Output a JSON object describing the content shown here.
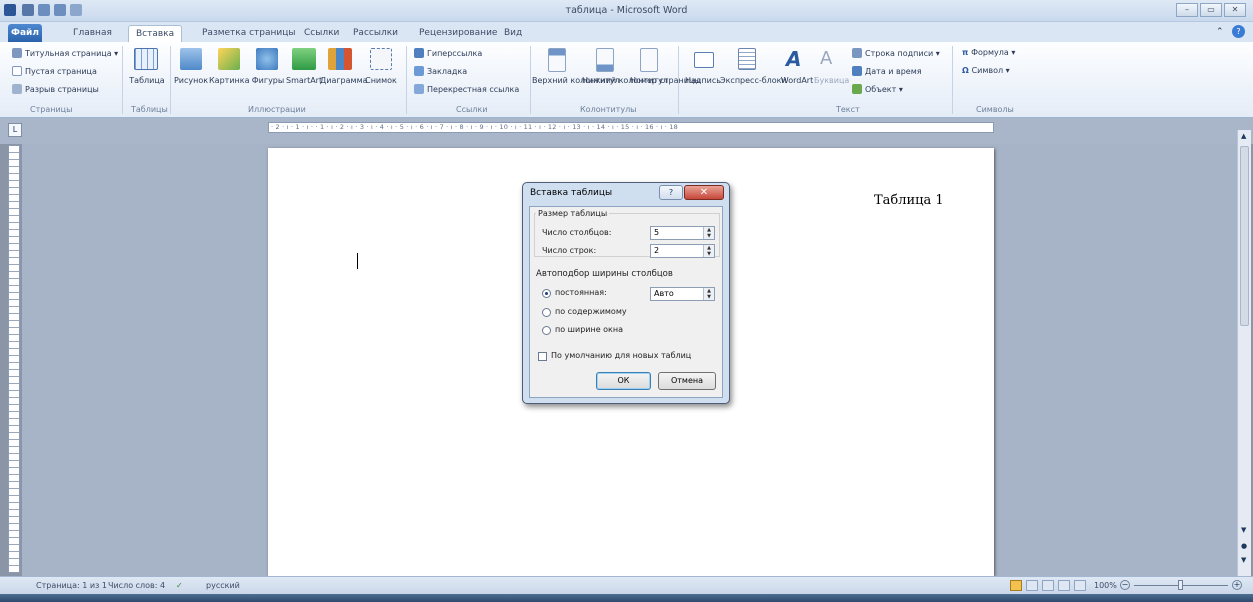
{
  "window": {
    "title": "таблица - Microsoft Word"
  },
  "tabs": {
    "file": "Файл",
    "items": [
      "Главная",
      "Вставка",
      "Разметка страницы",
      "Ссылки",
      "Рассылки",
      "Рецензирование",
      "Вид"
    ],
    "active": "Вставка"
  },
  "ribbon": {
    "pages": {
      "items": [
        "Титульная страница",
        "Пустая страница",
        "Разрыв страницы"
      ],
      "label": "Страницы"
    },
    "tables": {
      "button": "Таблица",
      "label": "Таблицы"
    },
    "illustrations": {
      "buttons": [
        "Рисунок",
        "Картинка",
        "Фигуры",
        "SmartArt",
        "Диаграмма",
        "Снимок"
      ],
      "label": "Иллюстрации"
    },
    "links": {
      "items": [
        "Гиперссылка",
        "Закладка",
        "Перекрестная ссылка"
      ],
      "label": "Ссылки"
    },
    "header_footer": {
      "buttons": [
        "Верхний колонтитул",
        "Нижний колонтитул",
        "Номер страницы"
      ],
      "label": "Колонтитулы"
    },
    "text": {
      "buttons": [
        "Надпись",
        "Экспресс-блоки",
        "WordArt",
        "Буквица"
      ],
      "right_items": [
        "Строка подписи",
        "Дата и время",
        "Объект"
      ],
      "label": "Текст"
    },
    "symbols": {
      "items": [
        "Формула",
        "Символ"
      ],
      "label": "Символы"
    }
  },
  "ruler": {
    "marks": "· 2 · ı · 1 · ı ·  · 1 · ı · 2 · ı · 3 · ı · 4 · ı · 5 · ı · 6 · ı · 7 · ı · 8 · ı · 9 · ı · 10 · ı · 11 · ı · 12 · ı · 13 · ı · 14 · ı · 15 · ı · 16 · ı · 18"
  },
  "document": {
    "caption": "Таблица 1"
  },
  "dialog": {
    "title": "Вставка таблицы",
    "size_group": "Размер таблицы",
    "columns_label": "Число столбцов:",
    "columns_value": "5",
    "rows_label": "Число строк:",
    "rows_value": "2",
    "autofit_group": "Автоподбор ширины столбцов",
    "fixed_label": "постоянная:",
    "fixed_value": "Авто",
    "content_label": "по содержимому",
    "window_label": "по ширине окна",
    "default_label": "По умолчанию для новых таблиц",
    "ok": "ОК",
    "cancel": "Отмена"
  },
  "status": {
    "page": "Страница: 1 из 1",
    "words": "Число слов: 4",
    "language": "русский",
    "zoom": "100%"
  }
}
